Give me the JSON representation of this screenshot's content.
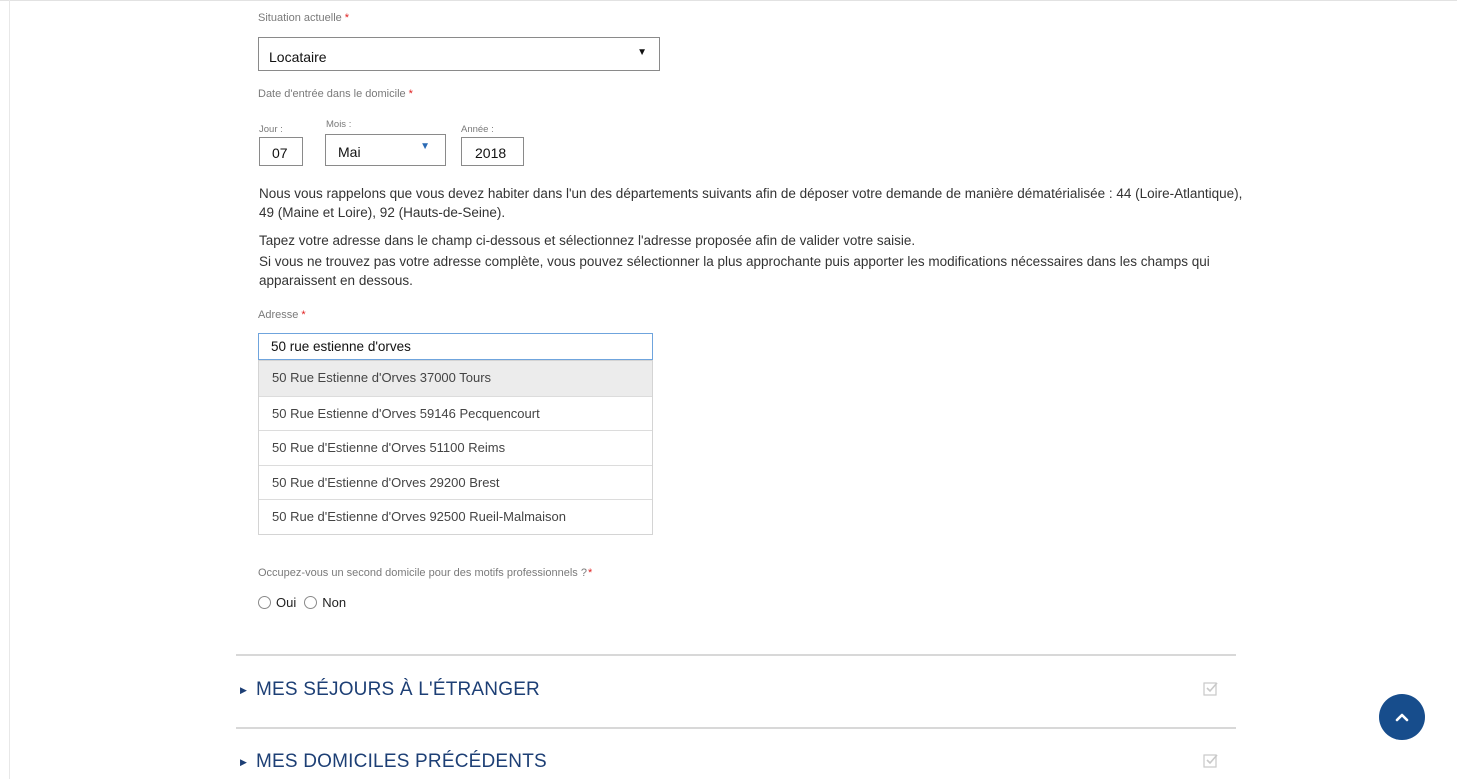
{
  "situation": {
    "label": "Situation actuelle",
    "required_mark": "*",
    "value": "Locataire",
    "caret_icon": "▼"
  },
  "entry_date": {
    "label": "Date d'entrée dans le domicile",
    "required_mark": "*",
    "day": {
      "label": "Jour :",
      "value": "07"
    },
    "month": {
      "label": "Mois :",
      "value": "Mai",
      "caret_icon": "▼"
    },
    "year": {
      "label": "Année :",
      "value": "2018"
    }
  },
  "info": {
    "line1": "Nous vous rappelons que vous devez habiter dans l'un des départements suivants afin de déposer votre demande de manière dématérialisée : 44 (Loire-Atlantique), 49 (Maine et Loire), 92 (Hauts-de-Seine).",
    "line2": "Tapez votre adresse dans le champ ci-dessous et sélectionnez l'adresse proposée afin de valider votre saisie.",
    "line3": "Si vous ne trouvez pas votre adresse complète, vous pouvez sélectionner la plus approchante puis apporter les modifications nécessaires dans les champs qui apparaissent en dessous."
  },
  "address": {
    "label": "Adresse",
    "required_mark": "*",
    "value": "50 rue estienne d'orves",
    "suggestions": [
      "50 Rue Estienne d'Orves 37000 Tours",
      "50 Rue Estienne d'Orves 59146 Pecquencourt",
      "50 Rue d'Estienne d'Orves 51100 Reims",
      "50 Rue d'Estienne d'Orves 29200 Brest",
      "50 Rue d'Estienne d'Orves 92500 Rueil-Malmaison"
    ]
  },
  "second_home": {
    "question": "Occupez-vous un second domicile pour des motifs professionnels ?",
    "required_mark": "*",
    "options": [
      "Oui",
      "Non"
    ]
  },
  "sections": [
    {
      "arrow_icon": "▶",
      "title": "MES SÉJOURS À L'ÉTRANGER",
      "icon": "checkbox-checked-icon"
    },
    {
      "arrow_icon": "▶",
      "title": "MES DOMICILES PRÉCÉDENTS",
      "icon": "checkbox-checked-icon"
    }
  ],
  "scroll_top": {
    "icon": "chevron-up-icon"
  },
  "colors": {
    "section_title": "#1d3f75",
    "scroll_button": "#174d8c",
    "required": "#e02020",
    "input_focus_border": "#6fa4dd"
  }
}
